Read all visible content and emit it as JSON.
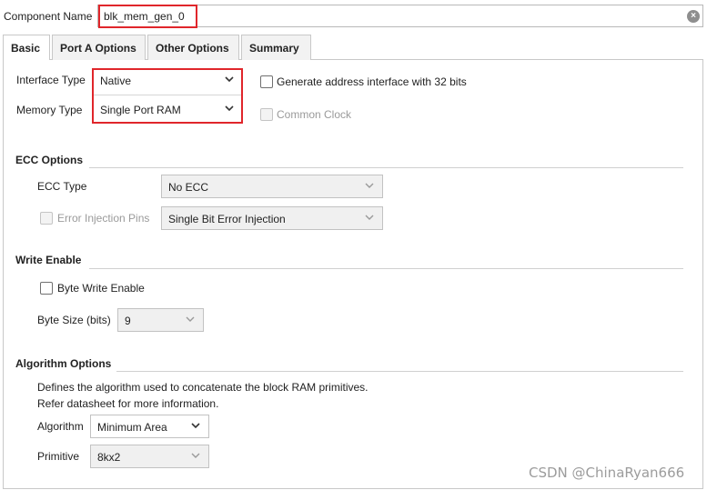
{
  "component": {
    "label": "Component Name",
    "value": "blk_mem_gen_0"
  },
  "tabs": [
    {
      "label": "Basic",
      "active": true
    },
    {
      "label": "Port A Options",
      "active": false
    },
    {
      "label": "Other Options",
      "active": false
    },
    {
      "label": "Summary",
      "active": false
    }
  ],
  "basic": {
    "interface_type_label": "Interface Type",
    "interface_type_value": "Native",
    "memory_type_label": "Memory Type",
    "memory_type_value": "Single Port RAM",
    "gen_addr_label": "Generate address interface with 32 bits",
    "common_clock_label": "Common Clock"
  },
  "ecc": {
    "title": "ECC Options",
    "ecc_type_label": "ECC Type",
    "ecc_type_value": "No ECC",
    "error_injection_label": "Error Injection Pins",
    "error_injection_value": "Single Bit Error Injection"
  },
  "write_enable": {
    "title": "Write Enable",
    "byte_write_label": "Byte Write Enable",
    "byte_size_label": "Byte Size (bits)",
    "byte_size_value": "9"
  },
  "algorithm": {
    "title": "Algorithm Options",
    "desc_line1": "Defines the algorithm used to concatenate the block RAM primitives.",
    "desc_line2": "Refer datasheet for more information.",
    "algorithm_label": "Algorithm",
    "algorithm_value": "Minimum Area",
    "primitive_label": "Primitive",
    "primitive_value": "8kx2"
  },
  "watermark": "CSDN @ChinaRyan666",
  "colors": {
    "highlight_red": "#e0262b",
    "border": "#c2c2c2",
    "disabled_text": "#9a9a9a"
  }
}
